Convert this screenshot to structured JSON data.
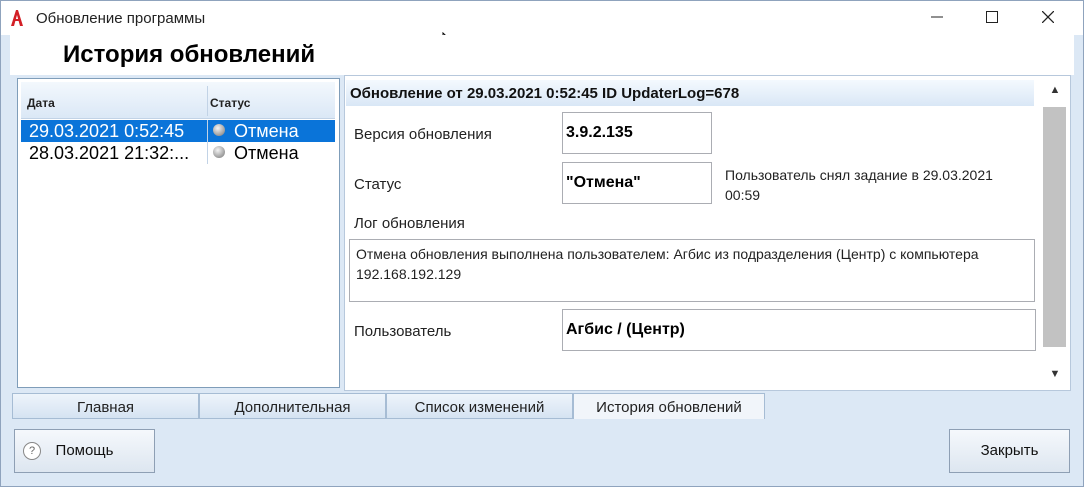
{
  "window": {
    "title": "Обновление программы",
    "minimize_glyph": "—",
    "maximize_glyph": "☐",
    "close_glyph": "✕",
    "app_icon": "app-logo-icon"
  },
  "page": {
    "heading": "История обновлений"
  },
  "history_grid": {
    "columns": {
      "date": "Дата",
      "status": "Статус"
    },
    "rows": [
      {
        "date": "29.03.2021 0:52:45",
        "status": "Отмена",
        "selected": true
      },
      {
        "date": "28.03.2021 21:32:...",
        "status": "Отмена",
        "selected": false
      }
    ]
  },
  "details": {
    "header": "Обновление от 29.03.2021 0:52:45  ID UpdaterLog=678",
    "version_label": "Версия обновления",
    "version_value": "3.9.2.135",
    "status_label": "Статус",
    "status_value": "\"Отмена\"",
    "status_note": "Пользователь снял задание в 29.03.2021 00:59",
    "log_label": "Лог обновления",
    "log_text": "Отмена обновления выполнена пользователем: Агбис из подразделения (Центр)  с компьютера 192.168.192.129",
    "user_label": "Пользователь",
    "user_value": "Агбис / (Центр)"
  },
  "scrollbar": {
    "up_glyph": "▲",
    "down_glyph": "▼"
  },
  "tabs": [
    {
      "label": "Главная",
      "active": false
    },
    {
      "label": "Дополнительная",
      "active": false
    },
    {
      "label": "Список изменений",
      "active": false
    },
    {
      "label": "История обновлений",
      "active": true
    }
  ],
  "buttons": {
    "help": "Помощь",
    "help_icon_glyph": "?",
    "close": "Закрыть"
  },
  "colors": {
    "selection": "#0a74d9",
    "window_bg": "#dce8f5"
  }
}
